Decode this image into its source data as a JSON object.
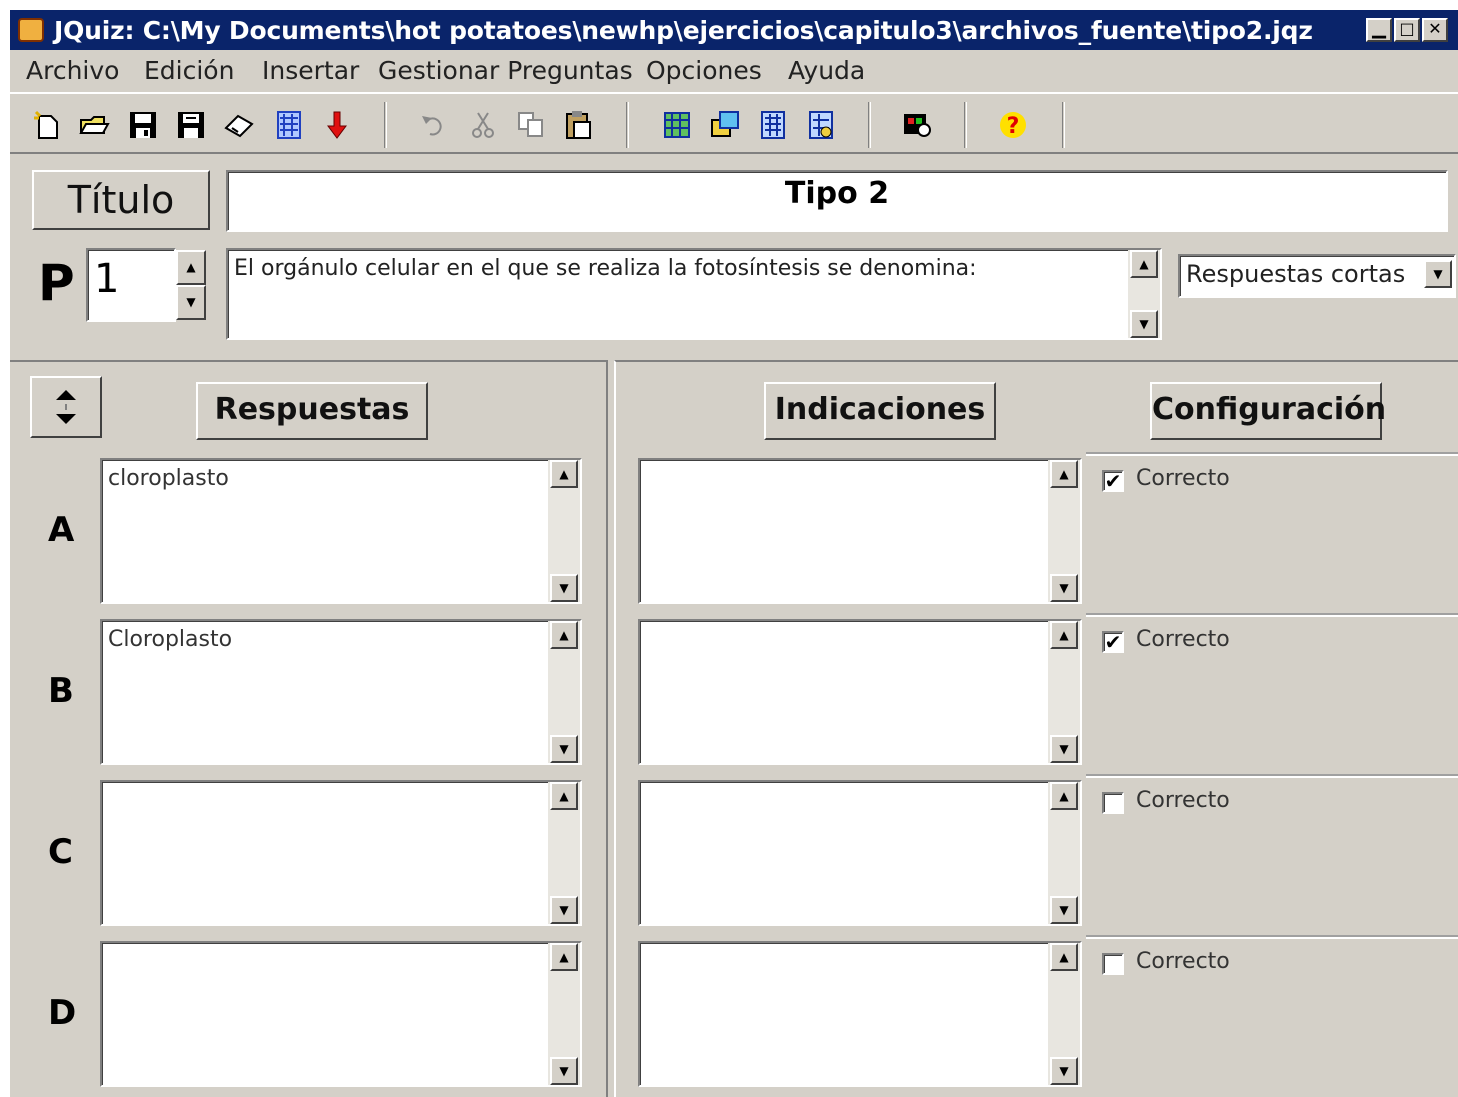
{
  "window": {
    "title": "JQuiz: C:\\My Documents\\hot potatoes\\newhp\\ejercicios\\capitulo3\\archivos_fuente\\tipo2.jqz",
    "minimize": "▁",
    "maximize": "□",
    "close": "✕"
  },
  "menu": [
    "Archivo",
    "Edición",
    "Insertar",
    "Gestionar Preguntas",
    "Opciones",
    "Ayuda"
  ],
  "toolbar": [
    "new-file-icon",
    "open-folder-icon",
    "save-icon",
    "save-as-icon",
    "eraser-icon",
    "web-page-icon",
    "arrow-down-icon",
    "undo-icon",
    "cut-icon",
    "copy-icon",
    "paste-icon",
    "insert-image-icon",
    "insert-link-icon",
    "insert-media-icon",
    "insert-object-icon",
    "configure-output-icon",
    "help-icon"
  ],
  "header": {
    "titulo_label": "Título",
    "titulo_value": "Tipo 2",
    "p_label": "P",
    "question_number": "1",
    "question_text": "El orgánulo celular en el que se realiza la fotosíntesis se denomina:",
    "question_type": "Respuestas cortas"
  },
  "columns": {
    "respuestas": "Respuestas",
    "indicaciones": "Indicaciones",
    "configuracion": "Configuración"
  },
  "answers": [
    {
      "letter": "A",
      "text": "cloroplasto",
      "feedback": "",
      "correct_label": "Correcto",
      "checked": true
    },
    {
      "letter": "B",
      "text": "Cloroplasto",
      "feedback": "",
      "correct_label": "Correcto",
      "checked": true
    },
    {
      "letter": "C",
      "text": "",
      "feedback": "",
      "correct_label": "Correcto",
      "checked": false
    },
    {
      "letter": "D",
      "text": "",
      "feedback": "",
      "correct_label": "Correcto",
      "checked": false
    }
  ],
  "glyphs": {
    "check": "✔",
    "spin_up": "▲",
    "spin_down": "▼"
  }
}
